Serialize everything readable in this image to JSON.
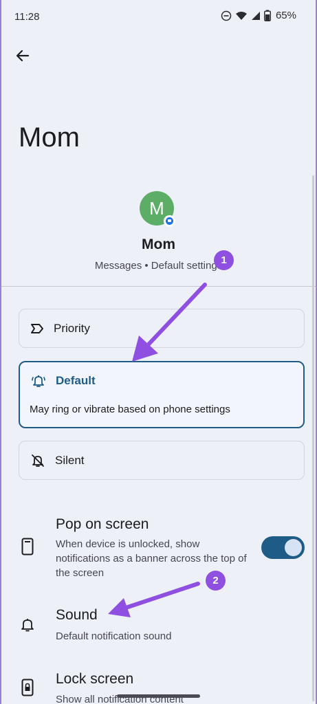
{
  "status_bar": {
    "time": "11:28",
    "battery": "65%",
    "icons": [
      "do-not-disturb-icon",
      "wifi-icon",
      "cell-signal-icon",
      "battery-icon"
    ]
  },
  "header": {
    "back_icon": "arrow-back-icon",
    "title": "Mom"
  },
  "contact": {
    "avatar_letter": "M",
    "avatar_color": "#5cad66",
    "name": "Mom",
    "subtitle": "Messages • Default settings"
  },
  "importance_options": [
    {
      "label": "Priority",
      "icon": "priority-icon",
      "selected": false
    },
    {
      "label": "Default",
      "icon": "bell-ring-icon",
      "selected": true,
      "description": "May ring or vibrate based on phone settings"
    },
    {
      "label": "Silent",
      "icon": "bell-off-icon",
      "selected": false
    }
  ],
  "settings": [
    {
      "title": "Pop on screen",
      "description": "When device is unlocked, show notifications as a banner across the top of the screen",
      "icon": "phone-icon",
      "toggle_on": true
    },
    {
      "title": "Sound",
      "description": "Default notification sound",
      "icon": "bell-icon"
    },
    {
      "title": "Lock screen",
      "description": "Show all notification content",
      "icon": "lock-screen-icon"
    }
  ],
  "annotations": {
    "badge_1": "1",
    "badge_2": "2",
    "arrow_color": "#8f4fe0"
  },
  "colors": {
    "accent": "#1e5b86",
    "background": "#eef0f8"
  }
}
